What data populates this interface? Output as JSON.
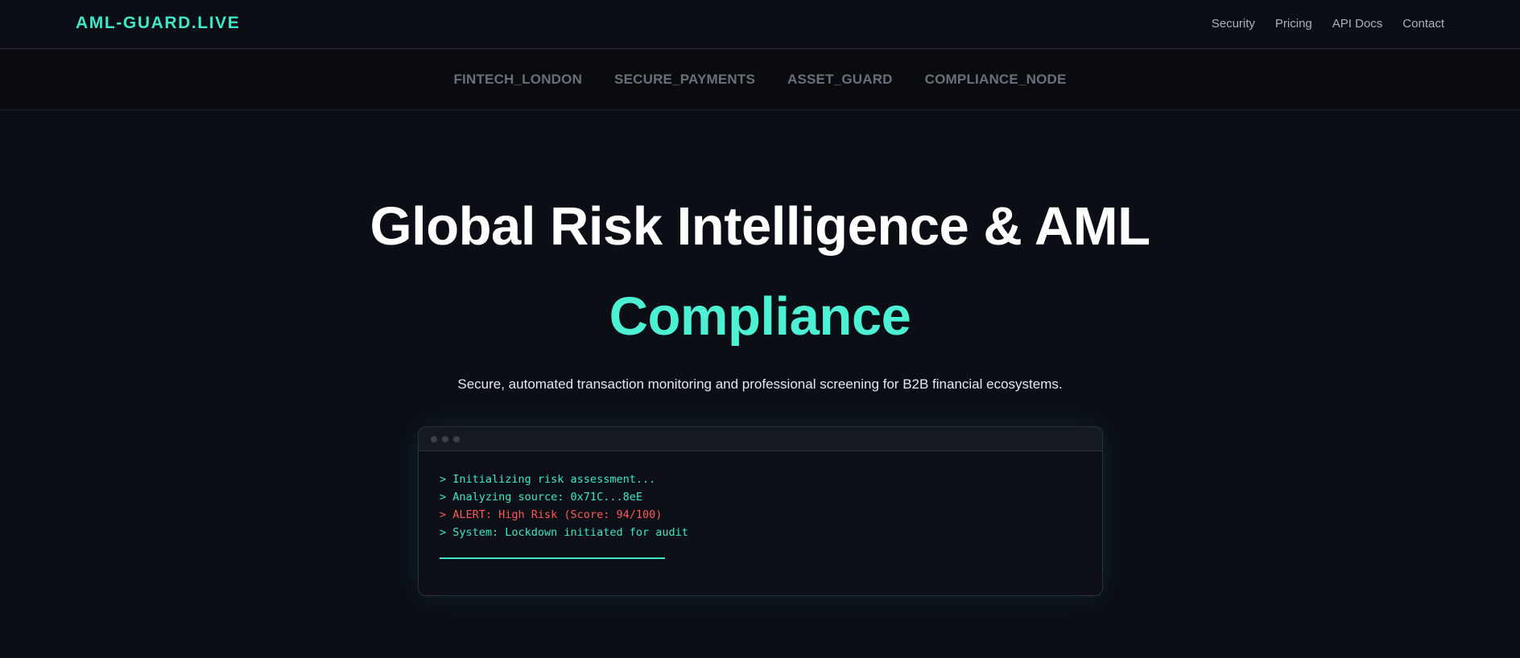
{
  "header": {
    "logo": "AML-GUARD.LIVE",
    "nav": [
      "Security",
      "Pricing",
      "API Docs",
      "Contact"
    ]
  },
  "partners": [
    "FINTECH_LONDON",
    "SECURE_PAYMENTS",
    "ASSET_GUARD",
    "COMPLIANCE_NODE"
  ],
  "hero": {
    "title": "Global Risk Intelligence & AML",
    "accent": "Compliance",
    "subtitle": "Secure, automated transaction monitoring and professional screening for B2B financial ecosystems."
  },
  "terminal": {
    "lines": [
      {
        "text": "> Initializing risk assessment...",
        "type": "info"
      },
      {
        "text": "> Analyzing source: 0x71C...8eE",
        "type": "info"
      },
      {
        "text": "> ALERT: High Risk (Score: 94/100)",
        "type": "alert"
      },
      {
        "text": "> System: Lockdown initiated for audit",
        "type": "info"
      }
    ]
  },
  "colors": {
    "accent": "#3ee8c8",
    "alert": "#ff5a5a",
    "background": "#0b0e14"
  }
}
